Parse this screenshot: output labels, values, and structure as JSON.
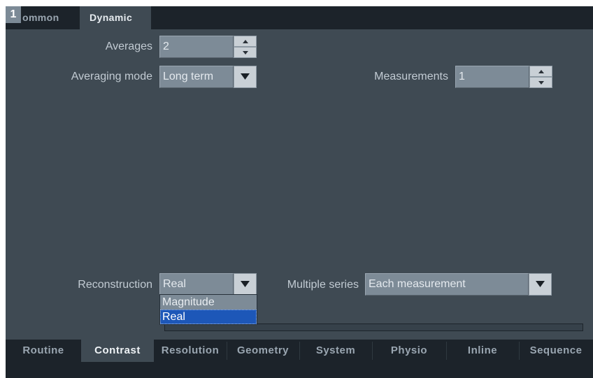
{
  "figure_label": "1",
  "top_tabs": [
    {
      "label": "ommon",
      "active": false
    },
    {
      "label": "Dynamic",
      "active": true
    }
  ],
  "fields": {
    "averages": {
      "label": "Averages",
      "value": "2"
    },
    "averaging_mode": {
      "label": "Averaging mode",
      "value": "Long term"
    },
    "measurements": {
      "label": "Measurements",
      "value": "1"
    },
    "reconstruction": {
      "label": "Reconstruction",
      "value": "Real",
      "options": [
        "Magnitude",
        "Real"
      ],
      "selected_option": "Real"
    },
    "multiple_series": {
      "label": "Multiple series",
      "value": "Each measurement"
    }
  },
  "progress": {
    "fraction": 0.0
  },
  "bottom_tabs": [
    {
      "label": "Routine",
      "active": false
    },
    {
      "label": "Contrast",
      "active": true
    },
    {
      "label": "Resolution",
      "active": false
    },
    {
      "label": "Geometry",
      "active": false
    },
    {
      "label": "System",
      "active": false
    },
    {
      "label": "Physio",
      "active": false
    },
    {
      "label": "Inline",
      "active": false
    },
    {
      "label": "Sequence",
      "active": false
    }
  ],
  "colors": {
    "panel_background": "#3f4a53",
    "bar_background": "#1c232a",
    "field_background": "#7d8b97",
    "selection_highlight": "#1d57b8"
  },
  "icons": {
    "spinner_up": "arrow-up-icon",
    "spinner_down": "arrow-down-icon",
    "dropdown": "chevron-down-icon"
  }
}
